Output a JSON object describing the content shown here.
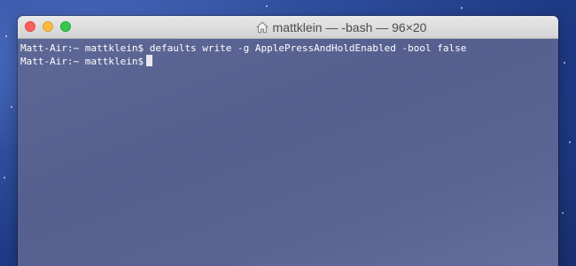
{
  "window": {
    "title": "mattklein — -bash — 96×20",
    "title_icon": "home-icon"
  },
  "terminal": {
    "lines": [
      {
        "prompt": "Matt-Air:~ mattklein$",
        "command": "defaults write -g ApplePressAndHoldEnabled -bool false"
      },
      {
        "prompt": "Matt-Air:~ mattklein$",
        "command": ""
      }
    ]
  },
  "colors": {
    "close": "#fc605c",
    "minimize": "#fdbc40",
    "zoom": "#34c84a",
    "terminal_bg": "#5a6492",
    "text": "#ffffff"
  }
}
